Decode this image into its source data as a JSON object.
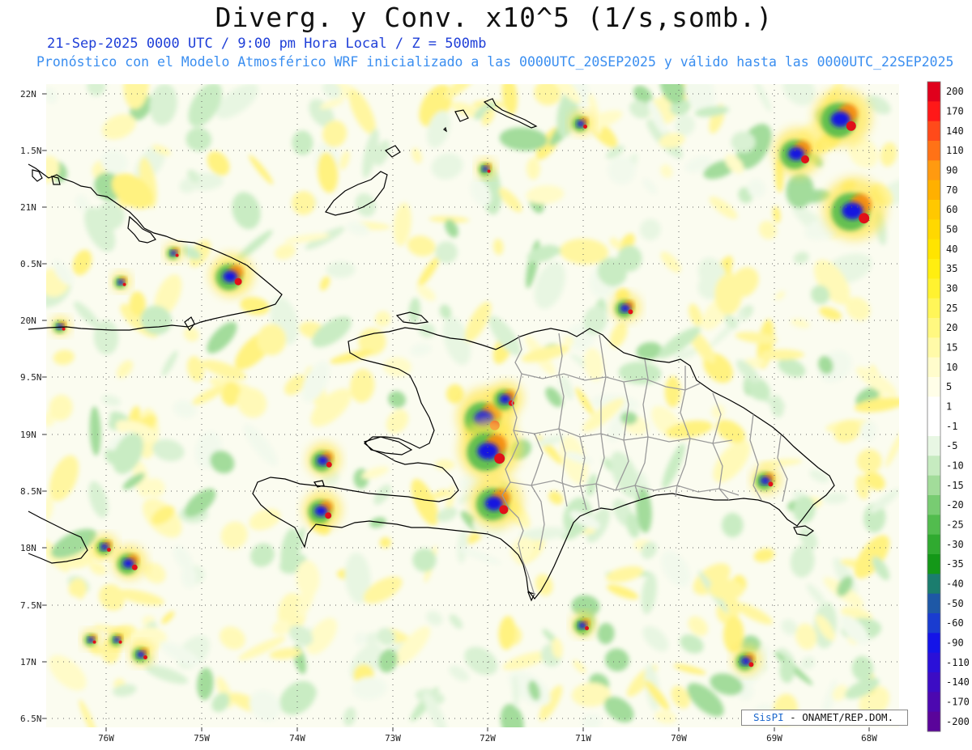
{
  "header": {
    "title": "Diverg. y Conv. x10^5 (1/s,somb.)",
    "subtitle_line1": "21-Sep-2025  0000 UTC / 9:00 pm Hora Local / Z = 500mb",
    "subtitle_line2": "Pronóstico con el Modelo Atmosférico WRF inicializado a las 0000UTC_20SEP2025 y válido hasta las  0000UTC_22SEP2025"
  },
  "map": {
    "lat_ticks": [
      "22N",
      "1.5N",
      "21N",
      "0.5N",
      "20N",
      "9.5N",
      "19N",
      "8.5N",
      "18N",
      "7.5N",
      "17N",
      "6.5N"
    ],
    "lon_ticks": [
      "76W",
      "75W",
      "74W",
      "73W",
      "72W",
      "71W",
      "70W",
      "69W",
      "68W"
    ]
  },
  "colorbar": {
    "labels": [
      "200",
      "170",
      "140",
      "110",
      "90",
      "70",
      "60",
      "50",
      "40",
      "35",
      "30",
      "25",
      "20",
      "15",
      "10",
      "5",
      "1",
      "-1",
      "-5",
      "-10",
      "-15",
      "-20",
      "-25",
      "-30",
      "-35",
      "-40",
      "-50",
      "-60",
      "-90",
      "-110",
      "-140",
      "-170",
      "-200"
    ],
    "colors": [
      "#e0001c",
      "#ff1818",
      "#ff4a1a",
      "#ff7216",
      "#ff9a10",
      "#ffb000",
      "#ffc800",
      "#ffd800",
      "#ffe400",
      "#ffee10",
      "#fff230",
      "#fff658",
      "#fff880",
      "#fffaa8",
      "#fffccc",
      "#fffee8",
      "#ffffff",
      "#ffffff",
      "#e8f7e4",
      "#c6ebc0",
      "#a2dc9a",
      "#78cc72",
      "#52bc4e",
      "#30aa30",
      "#149818",
      "#1b7d6e",
      "#1e58a6",
      "#1a3cd0",
      "#1414e8",
      "#2a10d8",
      "#3c0cc4",
      "#4c08b0",
      "#5a049a"
    ]
  },
  "credit": {
    "brand": "SisPI",
    "text": "- ONAMET/REP.DOM."
  }
}
